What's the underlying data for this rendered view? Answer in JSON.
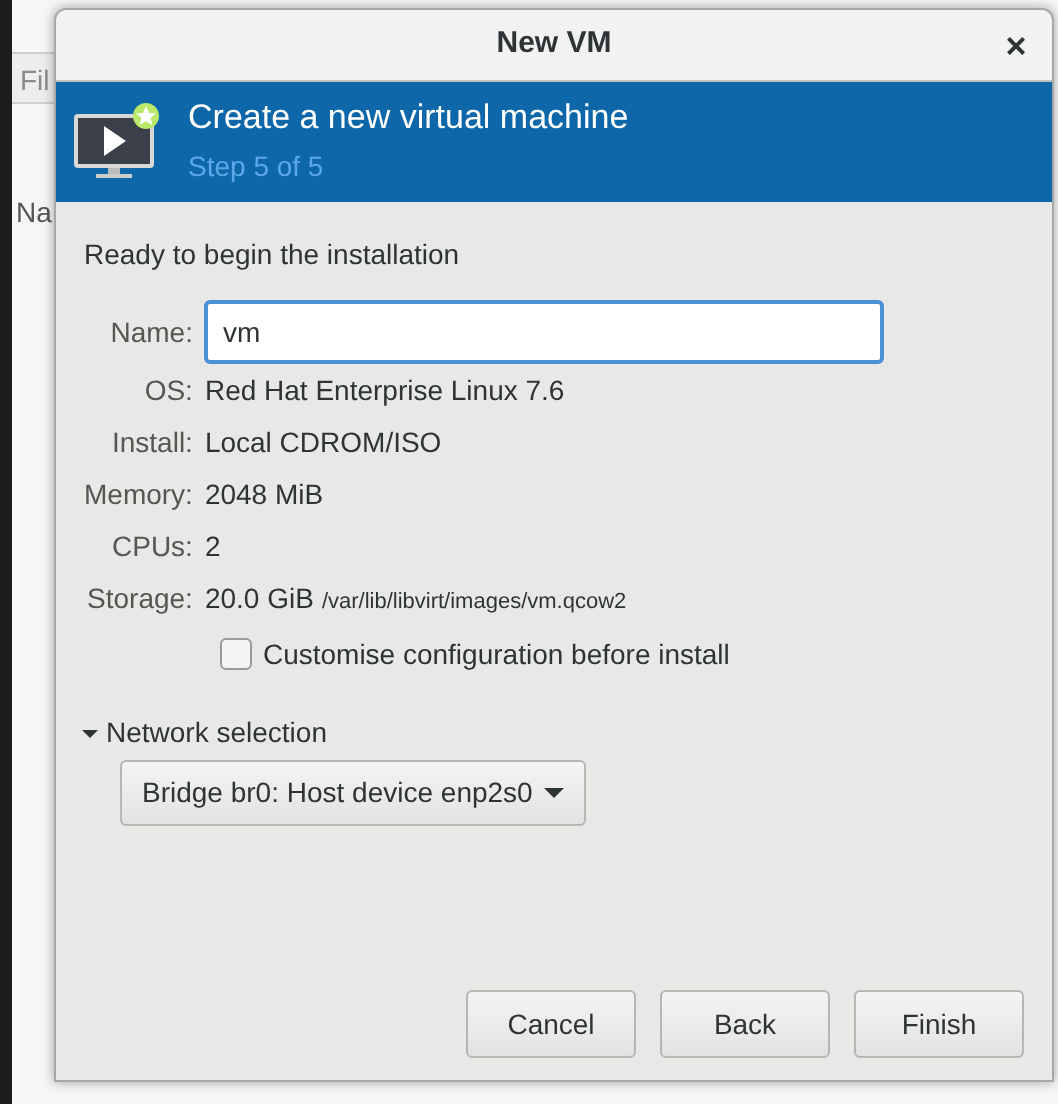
{
  "background_window": {
    "menu_text": "Fil",
    "column_text": "Na"
  },
  "dialog": {
    "title": "New VM",
    "close": "×"
  },
  "banner": {
    "title": "Create a new virtual machine",
    "subtitle": "Step 5 of 5"
  },
  "heading": "Ready to begin the installation",
  "name_field": {
    "label": "Name:",
    "value": "vm"
  },
  "details": [
    {
      "label": "OS:",
      "value": "Red Hat Enterprise Linux 7.6"
    },
    {
      "label": "Install:",
      "value": "Local CDROM/ISO"
    },
    {
      "label": "Memory:",
      "value": "2048 MiB"
    },
    {
      "label": "CPUs:",
      "value": "2"
    },
    {
      "label": "Storage:",
      "value": "20.0 GiB",
      "note": "/var/lib/libvirt/images/vm.qcow2"
    }
  ],
  "customise": {
    "label": "Customise configuration before install",
    "checked": false
  },
  "network": {
    "label": "Network selection",
    "expanded": true,
    "selection": "Bridge br0: Host device enp2s0"
  },
  "buttons": [
    "Cancel",
    "Back",
    "Finish"
  ]
}
